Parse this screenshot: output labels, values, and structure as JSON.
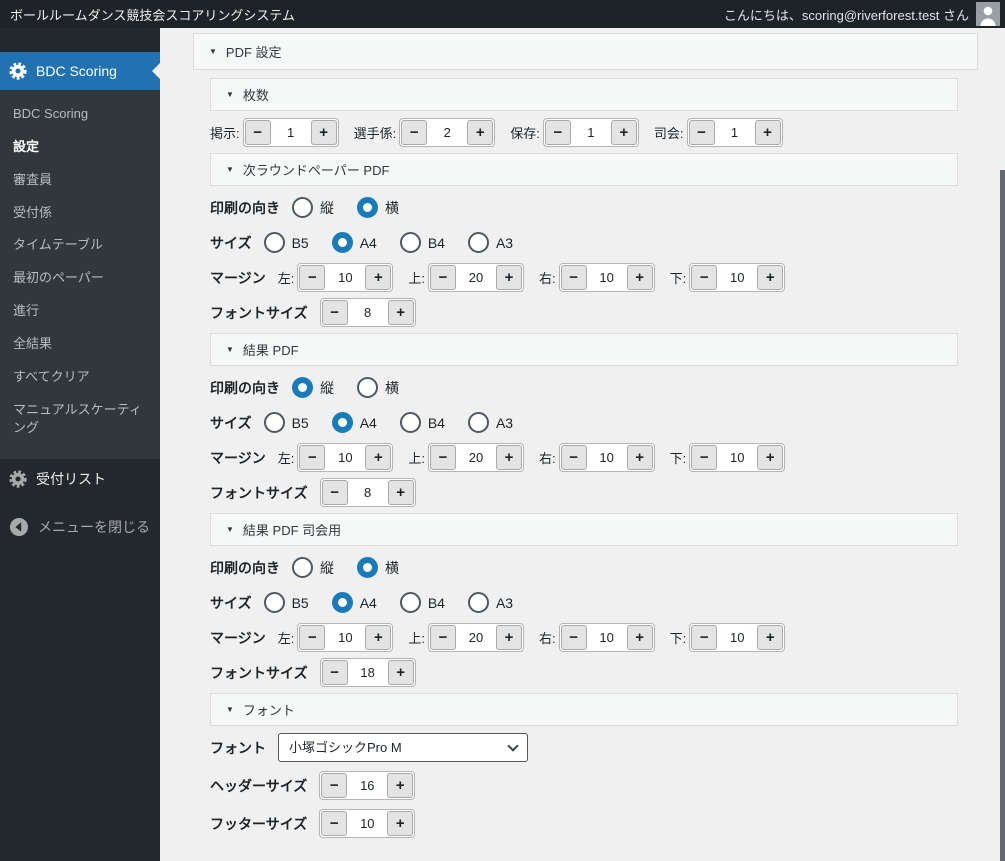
{
  "admin_bar": {
    "site_title": "ボールルームダンス競技会スコアリングシステム",
    "greeting": "こんにちは、scoring@riverforest.test さん"
  },
  "sidebar": {
    "active_item": {
      "label": "BDC Scoring"
    },
    "submenu": [
      {
        "label": "BDC Scoring",
        "current": false
      },
      {
        "label": "設定",
        "current": true
      },
      {
        "label": "審査員",
        "current": false
      },
      {
        "label": "受付係",
        "current": false
      },
      {
        "label": "タイムテーブル",
        "current": false
      },
      {
        "label": "最初のペーパー",
        "current": false
      },
      {
        "label": "進行",
        "current": false
      },
      {
        "label": "全結果",
        "current": false
      },
      {
        "label": "すべてクリア",
        "current": false
      },
      {
        "label": "マニュアルスケーティング",
        "current": false
      }
    ],
    "reception_list": {
      "label": "受付リスト"
    },
    "collapse_menu": {
      "label": "メニューを閉じる"
    }
  },
  "main": {
    "accordion_title": "PDF 設定",
    "sheet_counts": {
      "title": "枚数",
      "counters": [
        {
          "label": "掲示:",
          "value": "1"
        },
        {
          "label": "選手係:",
          "value": "2"
        },
        {
          "label": "保存:",
          "value": "1"
        },
        {
          "label": "司会:",
          "value": "1"
        }
      ]
    },
    "pdf_sections": [
      {
        "title": "次ラウンドペーパー PDF",
        "orientation_label": "印刷の向き",
        "orientation": [
          {
            "label": "縦",
            "selected": false
          },
          {
            "label": "横",
            "selected": true
          }
        ],
        "size_label": "サイズ",
        "sizes": [
          {
            "label": "B5",
            "selected": false
          },
          {
            "label": "A4",
            "selected": true
          },
          {
            "label": "B4",
            "selected": false
          },
          {
            "label": "A3",
            "selected": false
          }
        ],
        "margin_label": "マージン",
        "margins": [
          {
            "label": "左:",
            "value": "10"
          },
          {
            "label": "上:",
            "value": "20"
          },
          {
            "label": "右:",
            "value": "10"
          },
          {
            "label": "下:",
            "value": "10"
          }
        ],
        "font_size_label": "フォントサイズ",
        "font_size": "8"
      },
      {
        "title": "結果 PDF",
        "orientation_label": "印刷の向き",
        "orientation": [
          {
            "label": "縦",
            "selected": true
          },
          {
            "label": "横",
            "selected": false
          }
        ],
        "size_label": "サイズ",
        "sizes": [
          {
            "label": "B5",
            "selected": false
          },
          {
            "label": "A4",
            "selected": true
          },
          {
            "label": "B4",
            "selected": false
          },
          {
            "label": "A3",
            "selected": false
          }
        ],
        "margin_label": "マージン",
        "margins": [
          {
            "label": "左:",
            "value": "10"
          },
          {
            "label": "上:",
            "value": "20"
          },
          {
            "label": "右:",
            "value": "10"
          },
          {
            "label": "下:",
            "value": "10"
          }
        ],
        "font_size_label": "フォントサイズ",
        "font_size": "8"
      },
      {
        "title": "結果 PDF 司会用",
        "orientation_label": "印刷の向き",
        "orientation": [
          {
            "label": "縦",
            "selected": false
          },
          {
            "label": "横",
            "selected": true
          }
        ],
        "size_label": "サイズ",
        "sizes": [
          {
            "label": "B5",
            "selected": false
          },
          {
            "label": "A4",
            "selected": true
          },
          {
            "label": "B4",
            "selected": false
          },
          {
            "label": "A3",
            "selected": false
          }
        ],
        "margin_label": "マージン",
        "margins": [
          {
            "label": "左:",
            "value": "10"
          },
          {
            "label": "上:",
            "value": "20"
          },
          {
            "label": "右:",
            "value": "10"
          },
          {
            "label": "下:",
            "value": "10"
          }
        ],
        "font_size_label": "フォントサイズ",
        "font_size": "18"
      }
    ],
    "font_section": {
      "title": "フォント",
      "font_label": "フォント",
      "font_value": "小塚ゴシックPro M",
      "header_size_label": "ヘッダーサイズ",
      "header_size": "16",
      "footer_size_label": "フッターサイズ",
      "footer_size": "10"
    }
  },
  "stepper": {
    "minus": "−",
    "plus": "+"
  },
  "colors": {
    "accent_blue": "#2271b1",
    "radio_blue": "#1a7bb9",
    "adminbar_bg": "#1d2327",
    "sidebar_bg": "#23282d",
    "submenu_bg": "#32373c",
    "content_bg": "#f0f0f1"
  }
}
